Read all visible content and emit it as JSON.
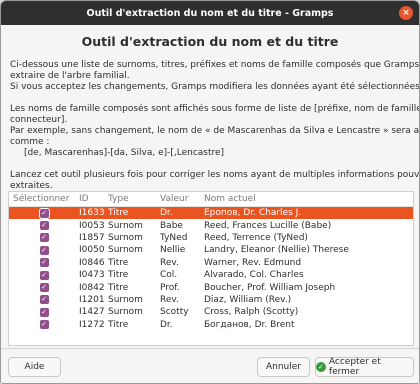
{
  "window": {
    "title": "Outil d'extraction du nom et du titre - Gramps",
    "close_icon": "×"
  },
  "dialog": {
    "heading": "Outil d'extraction du nom et du titre",
    "intro_lines": [
      "Ci-dessous une liste de surnoms, titres, préfixes et noms de famille composés que Gramps peut",
      "extraire de l'arbre familial.",
      "Si vous acceptez les changements, Gramps modifiera les données ayant été sélectionnées."
    ],
    "compound_lines": [
      "Les noms de famille composés sont affichés sous forme de liste de [préfixe, nom de famille,",
      "connecteur].",
      "Par exemple, sans changement, le nom de « de Mascarenhas da Silva e Lencastre » sera affiché",
      "comme :",
      "[de, Mascarenhas]-[da, Silva, e]-[,Lencastre]"
    ],
    "launch_lines": [
      "Lancez cet outil plusieurs fois pour corriger les noms ayant de multiples informations pouvant être",
      "extraites."
    ]
  },
  "table": {
    "columns": [
      "Sélectionner",
      "ID",
      "Type",
      "Valeur",
      "Nom actuel"
    ],
    "check_icon": "✓",
    "rows": [
      {
        "id": "I1633",
        "type": "Titre",
        "value": "Dr.",
        "name": "Еропов, Dr. Charles J.",
        "selected": true
      },
      {
        "id": "I0053",
        "type": "Surnom",
        "value": "Babe",
        "name": "Reed, Frances Lucille (Babe)",
        "selected": false
      },
      {
        "id": "I1857",
        "type": "Surnom",
        "value": "TyNed",
        "name": "Reed, Terrence (TyNed)",
        "selected": false
      },
      {
        "id": "I0050",
        "type": "Surnom",
        "value": "Nellie",
        "name": "Landry, Eleanor (Nellie) Therese",
        "selected": false
      },
      {
        "id": "I0846",
        "type": "Titre",
        "value": "Rev.",
        "name": "Warner, Rev. Edmund",
        "selected": false
      },
      {
        "id": "I0473",
        "type": "Titre",
        "value": "Col.",
        "name": "Alvarado, Col. Charles",
        "selected": false
      },
      {
        "id": "I0842",
        "type": "Titre",
        "value": "Prof.",
        "name": "Boucher, Prof. William Joseph",
        "selected": false
      },
      {
        "id": "I1201",
        "type": "Surnom",
        "value": "Rev.",
        "name": "Diaz, William (Rev.)",
        "selected": false
      },
      {
        "id": "I1427",
        "type": "Surnom",
        "value": "Scotty",
        "name": "Cross, Ralph (Scotty)",
        "selected": false
      },
      {
        "id": "I1272",
        "type": "Titre",
        "value": "Dr.",
        "name": "Богданов, Dr. Brent",
        "selected": false
      }
    ]
  },
  "buttons": {
    "help": "Aide",
    "cancel": "Annuler",
    "accept": "Accepter et fermer",
    "accept_icon": "✓"
  },
  "colors": {
    "accent": "#e95420",
    "checkbox": "#924d8b",
    "titlebar": "#2f2f2f"
  }
}
